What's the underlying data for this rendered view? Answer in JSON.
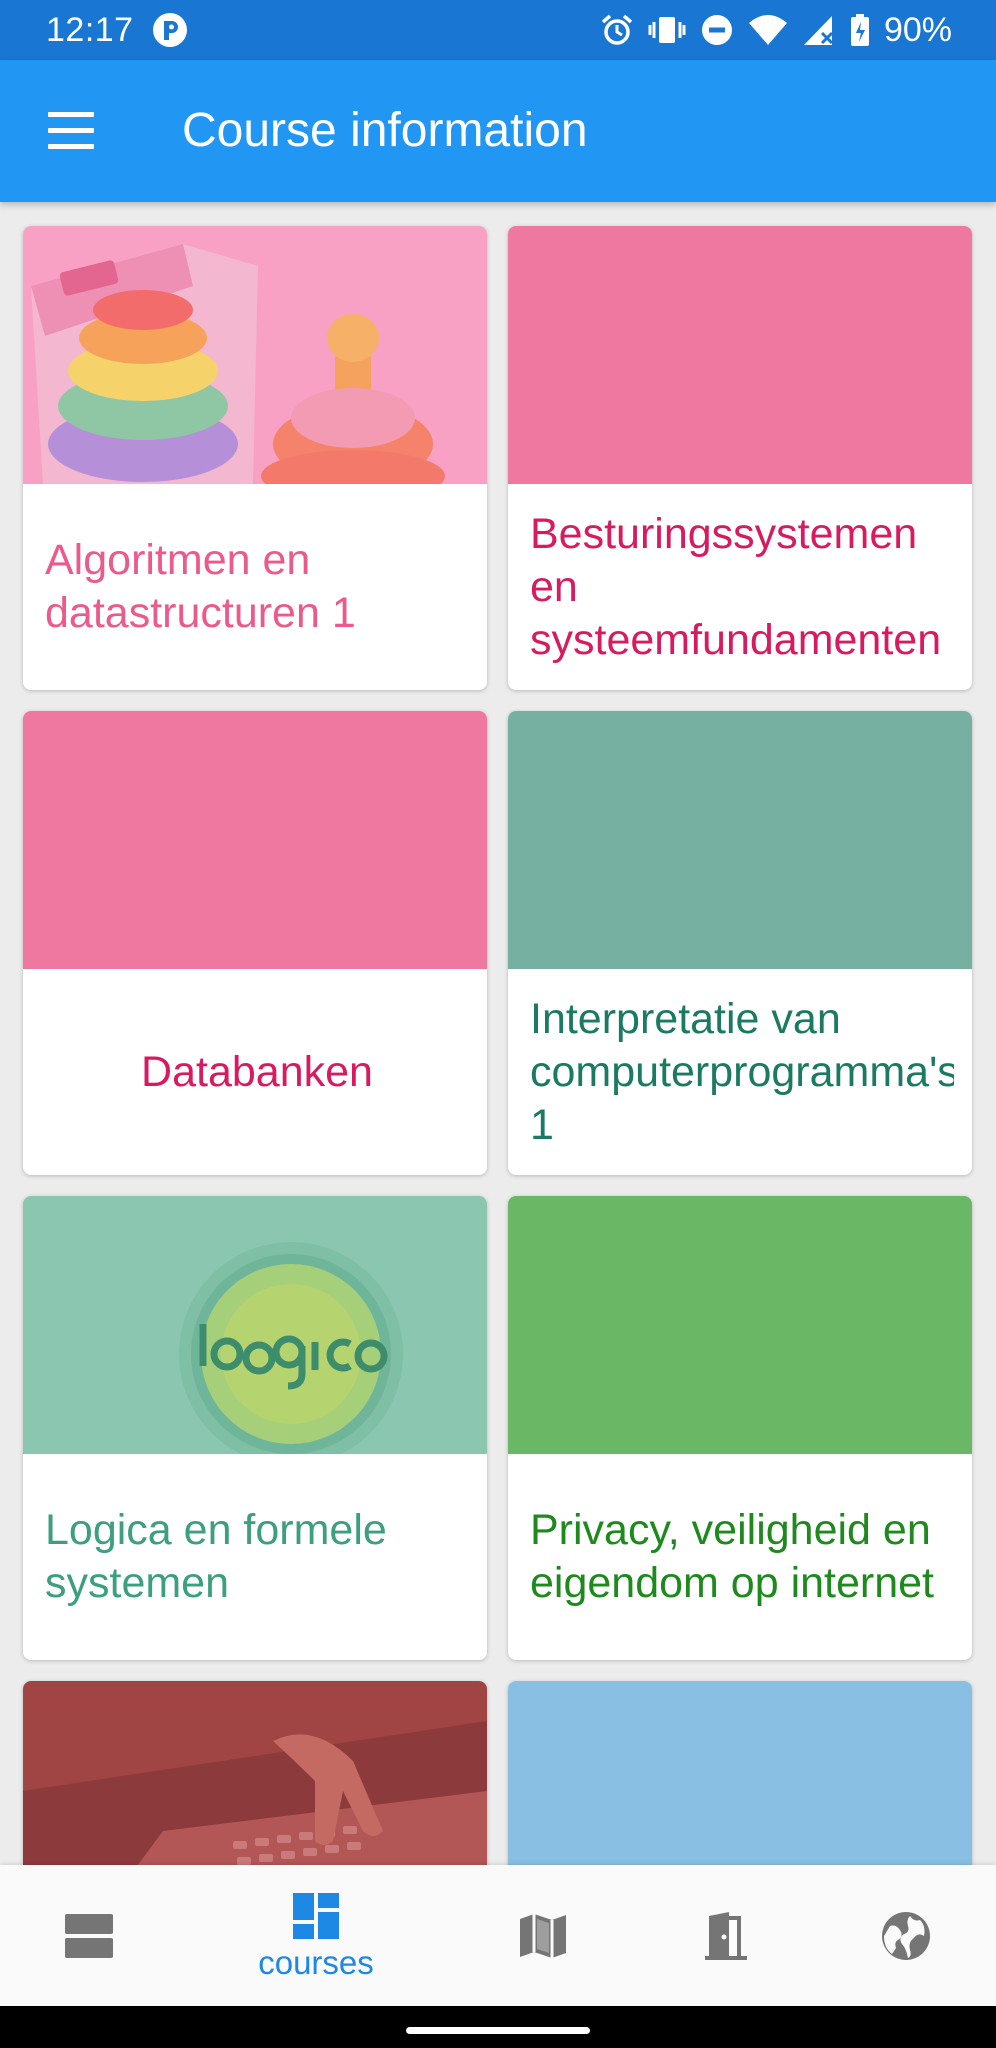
{
  "status_bar": {
    "time": "12:17",
    "battery": "90%",
    "icons": [
      "app-notification-icon",
      "alarm-icon",
      "vibrate-icon",
      "do-not-disturb-icon",
      "wifi-icon",
      "cell-signal-icon",
      "battery-icon"
    ]
  },
  "app_bar": {
    "title": "Course information",
    "menu_icon": "hamburger-menu-icon"
  },
  "courses": [
    {
      "title": "Algoritmen en datastructuren 1",
      "image": "toy-stacking-rings",
      "accent": "#f06292",
      "title_color": "#ec5a8c"
    },
    {
      "title": "Besturingssystemen en systeemfundamenten",
      "image": "solid",
      "accent": "#ee789f",
      "title_color": "#d81b60"
    },
    {
      "title": "Databanken",
      "image": "solid",
      "accent": "#ee789f",
      "title_color": "#d81b60"
    },
    {
      "title": "Interpretatie van computerprogramma's 1",
      "image": "solid",
      "accent": "#76b0a1",
      "title_color": "#1b7a62"
    },
    {
      "title": "Logica en formele systemen",
      "image": "logica-logo",
      "accent": "#8bc7b0",
      "title_color": "#3c9f7d"
    },
    {
      "title": "Privacy, veiligheid en eigendom op internet",
      "image": "solid",
      "accent": "#6ab765",
      "title_color": "#1e8a1e"
    },
    {
      "title": "",
      "image": "keyboard-hands",
      "accent": "#a04444",
      "title_color": ""
    },
    {
      "title": "",
      "image": "solid",
      "accent": "#89bfe2",
      "title_color": ""
    }
  ],
  "bottom_nav": {
    "items": [
      {
        "icon": "agenda-icon",
        "label": "",
        "active": false
      },
      {
        "icon": "dashboard-icon",
        "label": "courses",
        "active": true
      },
      {
        "icon": "map-icon",
        "label": "",
        "active": false
      },
      {
        "icon": "door-icon",
        "label": "",
        "active": false
      },
      {
        "icon": "globe-icon",
        "label": "",
        "active": false
      }
    ]
  },
  "colors": {
    "status_bar": "#1976d2",
    "app_bar": "#2196f3",
    "active_nav": "#1e88e5",
    "inactive_nav": "#757575"
  }
}
